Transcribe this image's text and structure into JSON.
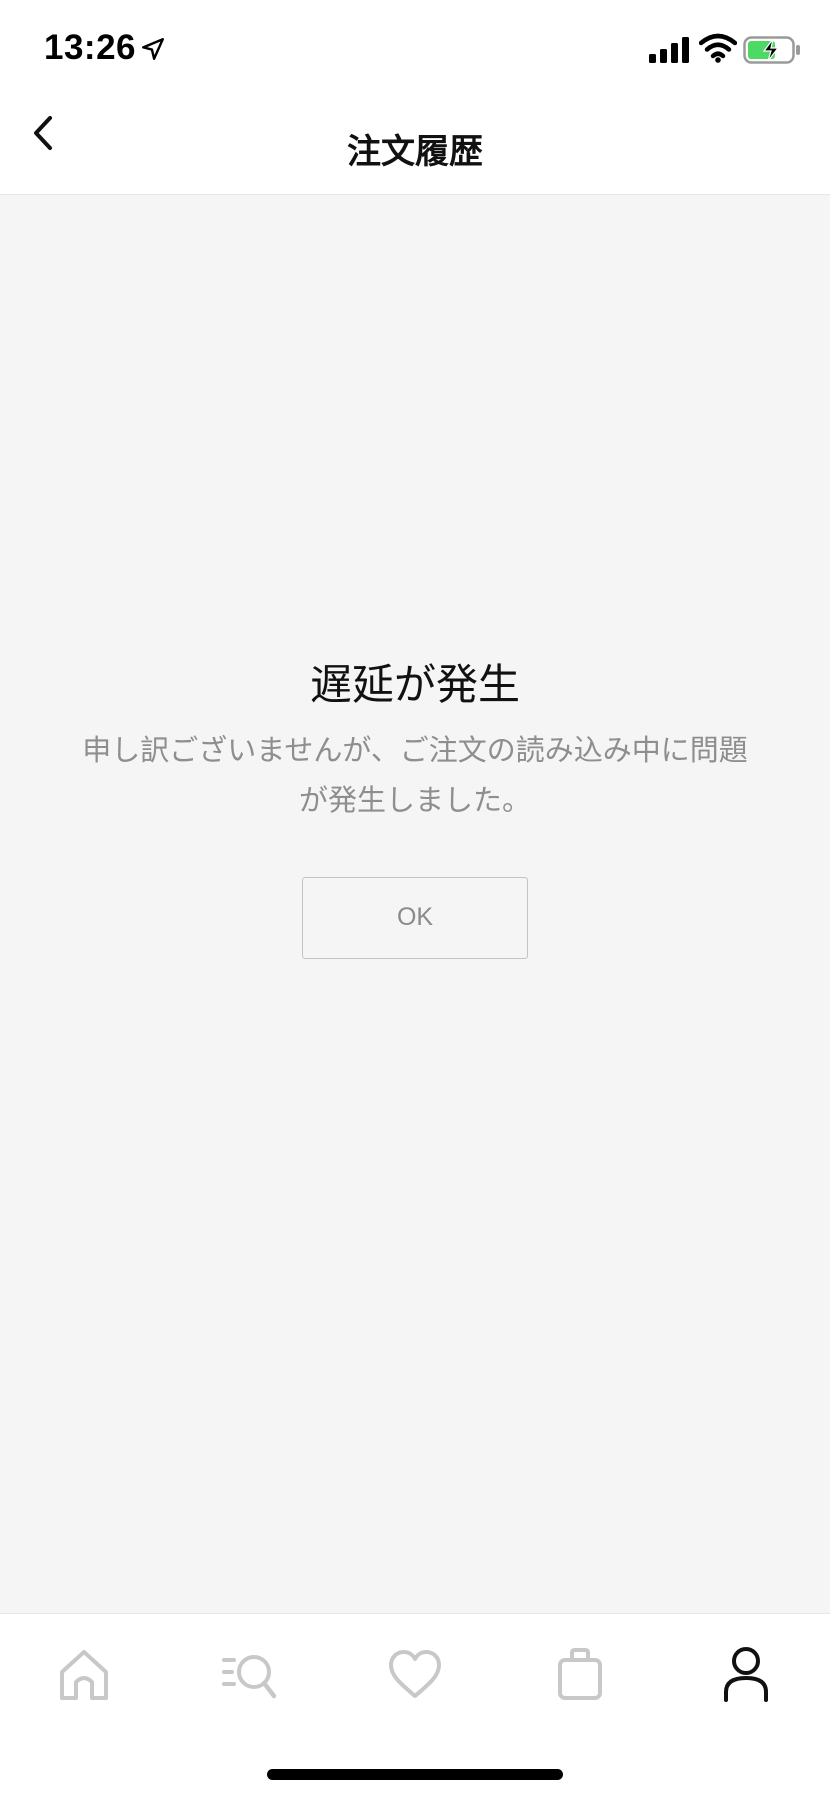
{
  "status_bar": {
    "time": "13:26",
    "icons": [
      "location-arrow-icon",
      "cellular-signal-icon",
      "wifi-icon",
      "battery-charging-icon"
    ],
    "battery_color": "#4cd964"
  },
  "nav": {
    "title": "注文履歴",
    "back_icon": "chevron-left-icon"
  },
  "error": {
    "title": "遅延が発生",
    "message_line1": "申し訳ございませんが、ご注文の読み込み中に問題",
    "message_line2": "が発生しました。",
    "ok_label": "OK"
  },
  "tab_bar": {
    "tabs": [
      {
        "icon": "home-icon",
        "active": false
      },
      {
        "icon": "search-list-icon",
        "active": false
      },
      {
        "icon": "heart-icon",
        "active": false
      },
      {
        "icon": "bag-icon",
        "active": false
      },
      {
        "icon": "person-icon",
        "active": true
      }
    ],
    "active_color": "#111111",
    "inactive_color": "#c8c8c8"
  }
}
